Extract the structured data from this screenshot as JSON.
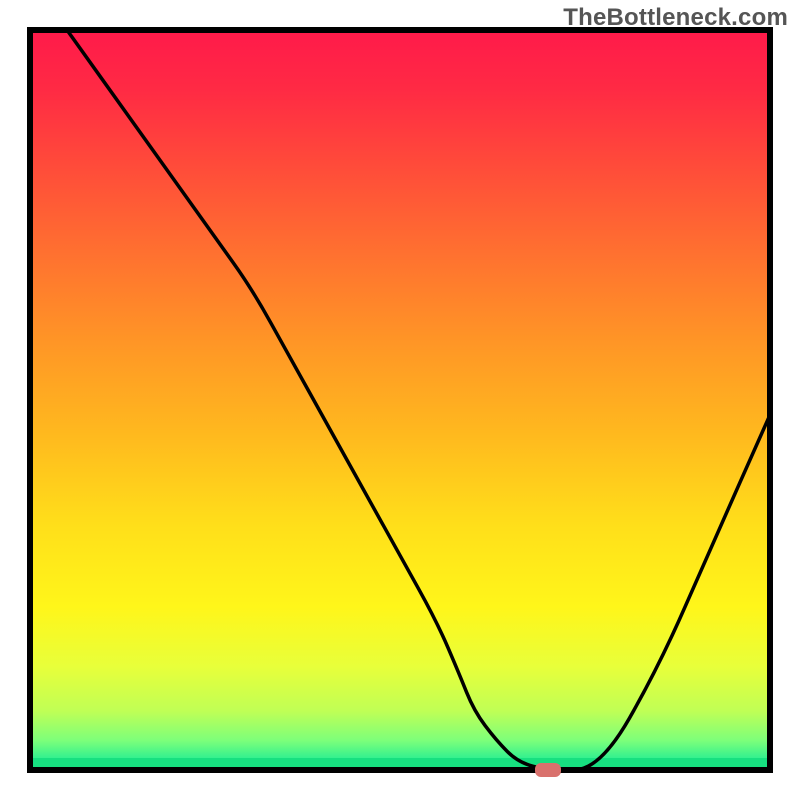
{
  "watermark": "TheBottleneck.com",
  "marker_color": "#d9716d",
  "gradient_stops": [
    {
      "offset": 0.0,
      "color": "#ff1a4a"
    },
    {
      "offset": 0.08,
      "color": "#ff2a44"
    },
    {
      "offset": 0.18,
      "color": "#ff4a3a"
    },
    {
      "offset": 0.3,
      "color": "#ff7030"
    },
    {
      "offset": 0.42,
      "color": "#ff9526"
    },
    {
      "offset": 0.55,
      "color": "#ffba1e"
    },
    {
      "offset": 0.67,
      "color": "#ffdf1a"
    },
    {
      "offset": 0.78,
      "color": "#fff61a"
    },
    {
      "offset": 0.86,
      "color": "#e8ff3a"
    },
    {
      "offset": 0.92,
      "color": "#c0ff55"
    },
    {
      "offset": 0.96,
      "color": "#7dff7a"
    },
    {
      "offset": 0.985,
      "color": "#30f090"
    },
    {
      "offset": 1.0,
      "color": "#17e080"
    }
  ],
  "chart_data": {
    "type": "line",
    "title": "",
    "xlabel": "",
    "ylabel": "",
    "xlim": [
      0,
      100
    ],
    "ylim": [
      0,
      100
    ],
    "series": [
      {
        "name": "curve",
        "x": [
          5,
          15,
          25,
          30,
          35,
          40,
          45,
          50,
          55,
          58,
          60,
          63,
          66,
          70,
          77,
          85,
          92,
          100
        ],
        "y": [
          100,
          86,
          72,
          65,
          56,
          47,
          38,
          29,
          20,
          13,
          8,
          4,
          1,
          0,
          0,
          14,
          30,
          48
        ]
      }
    ],
    "marker": {
      "x": 70,
      "y": 0
    }
  }
}
